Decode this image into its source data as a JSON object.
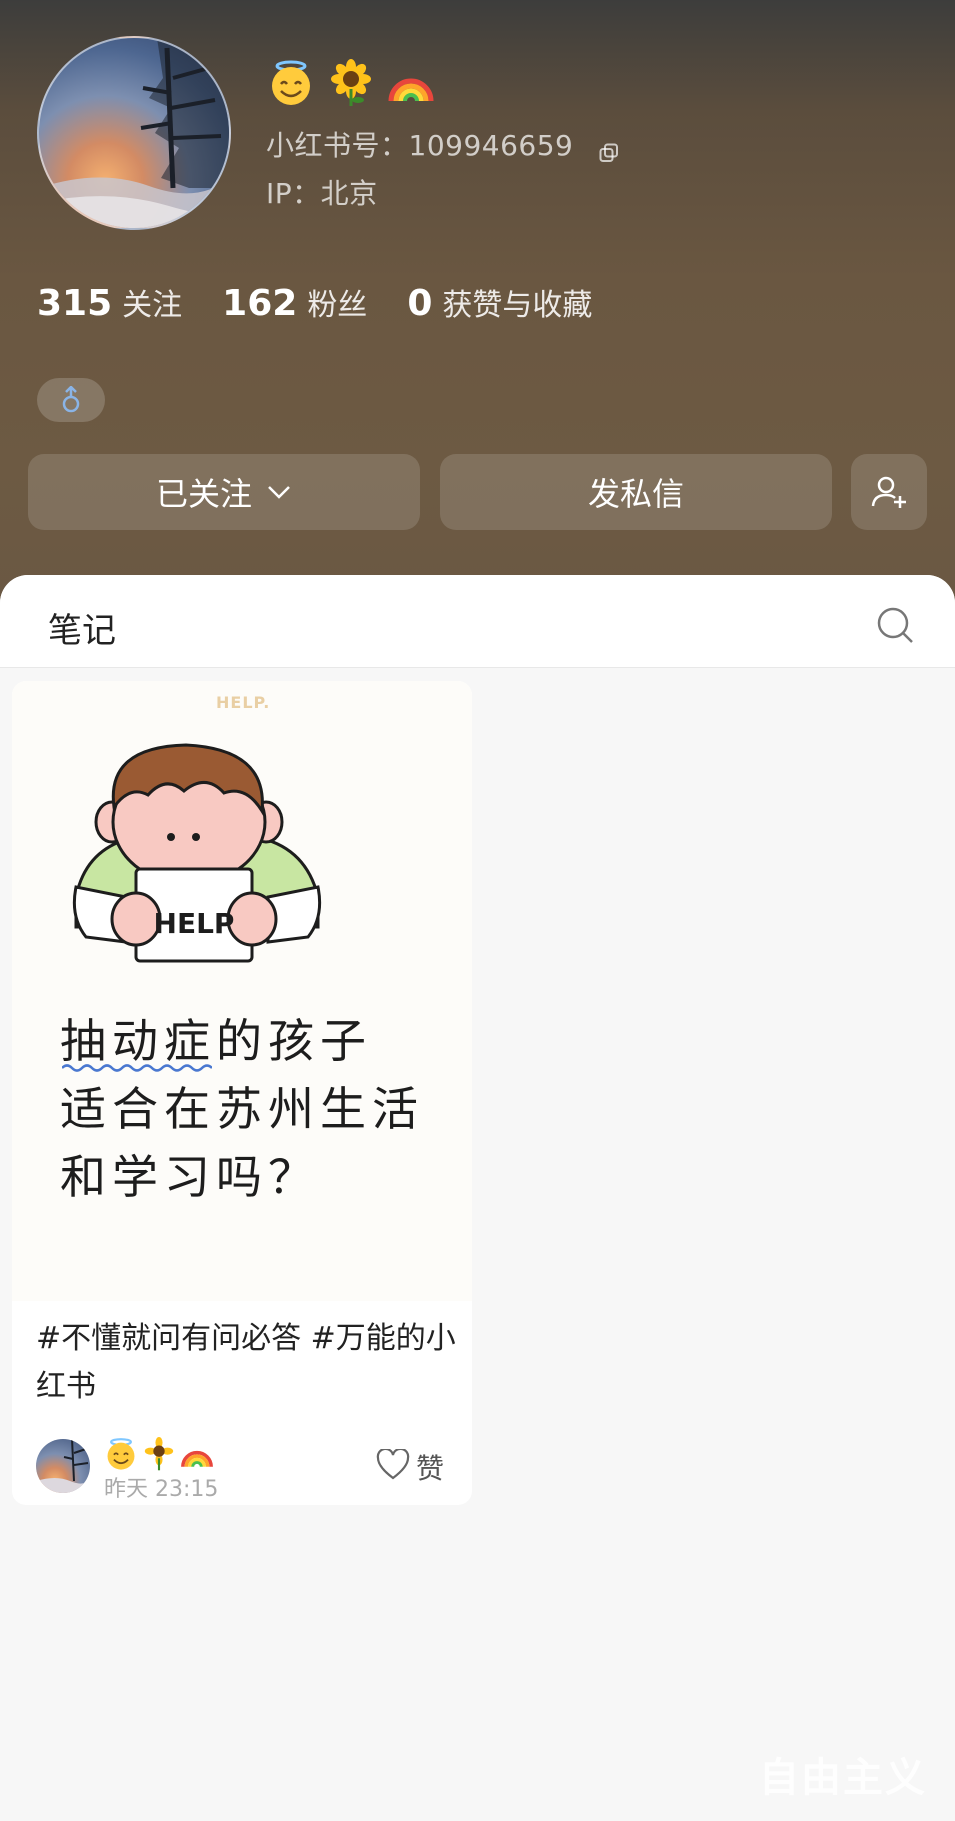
{
  "profile": {
    "emojis": [
      "😇",
      "🌻",
      "🌈"
    ],
    "id_label": "小红书号：",
    "id_value": "109946659",
    "ip_text": "IP：北京",
    "stats": [
      {
        "num": "315",
        "label": "关注"
      },
      {
        "num": "162",
        "label": "粉丝"
      },
      {
        "num": "0",
        "label": "获赞与收藏"
      }
    ],
    "gender_symbol": "♂"
  },
  "actions": {
    "follow_label": "已关注",
    "message_label": "发私信",
    "add_friend_icon": "add-user-icon"
  },
  "tabs": {
    "title": "笔记",
    "search_icon": "search-icon"
  },
  "notes": [
    {
      "cover_hand": "HELP.",
      "cover_sign": "HELP",
      "cover_lines": [
        "抽动症的孩子",
        "适合在苏州生活",
        "和学习吗？"
      ],
      "title": "#不懂就问有问必答 #万能的小红书",
      "author_emojis": [
        "😇",
        "🌻",
        "🌈"
      ],
      "time": "昨天 23:15",
      "like_label": "赞"
    }
  ],
  "watermark": "自由主义",
  "colors": {
    "hero_top": "#3d3d3c",
    "hero_bottom": "#6a5843",
    "gender_icon": "#8ab4e6",
    "underline": "#4a78d0"
  }
}
